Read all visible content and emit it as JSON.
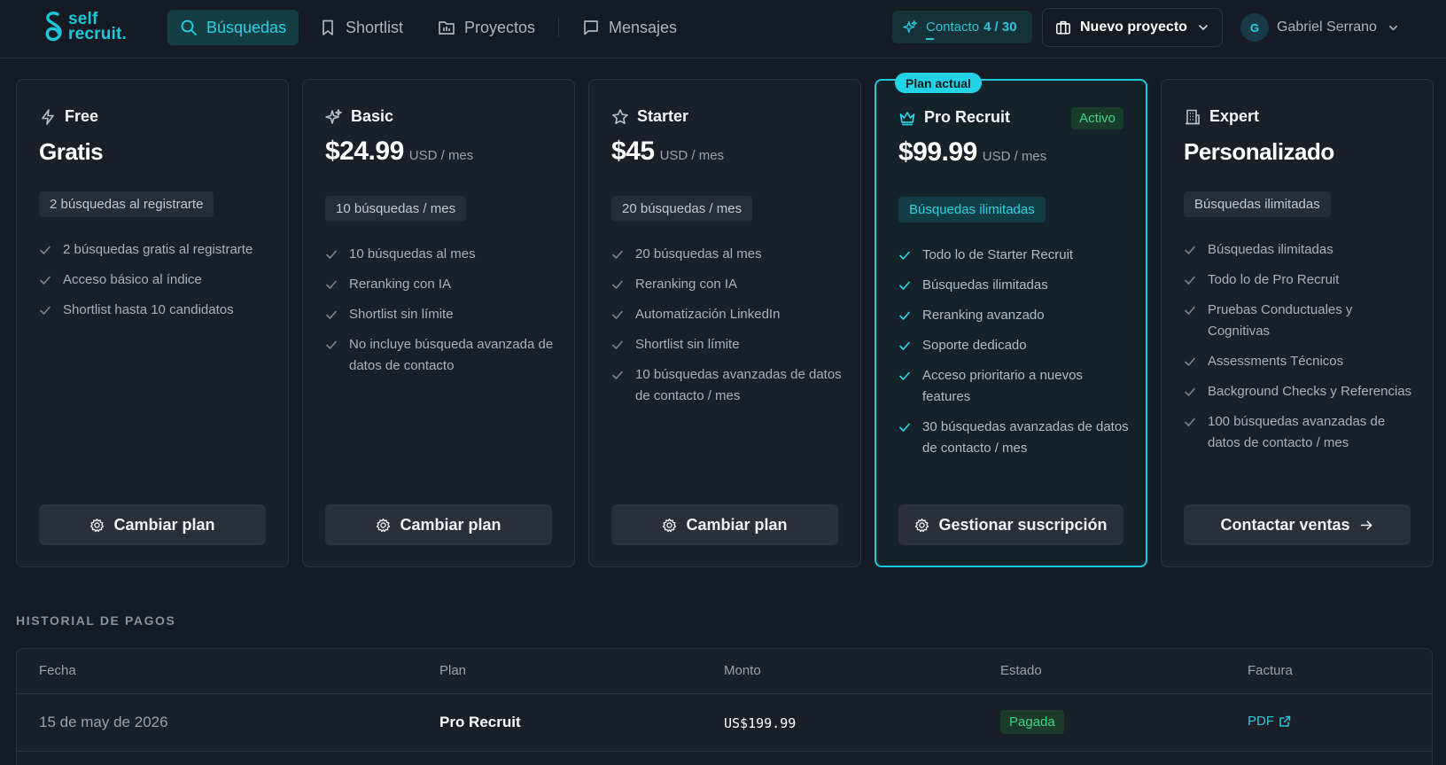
{
  "brand": {
    "line1": "self",
    "line2": "recruit.",
    "accent": "#1cc8dc"
  },
  "nav": [
    {
      "label": "Búsquedas",
      "icon": "search-icon",
      "active": true
    },
    {
      "label": "Shortlist",
      "icon": "bookmark-icon",
      "active": false
    },
    {
      "label": "Proyectos",
      "icon": "folder-icon",
      "active": false
    },
    {
      "label": "Mensajes",
      "icon": "message-icon",
      "active": false
    }
  ],
  "contact": {
    "label": "Contacto",
    "count": "4 / 30",
    "icon": "sparkles-icon"
  },
  "project_select": {
    "label": "Nuevo proyecto",
    "icon": "briefcase-icon"
  },
  "user": {
    "initial": "G",
    "name": "Gabriel Serrano"
  },
  "plans": [
    {
      "name": "Free",
      "icon": "bolt-icon",
      "price": "Gratis",
      "unit": "",
      "quota": "2 búsquedas al registrarte",
      "features": [
        "2 búsquedas gratis al registrarte",
        "Acceso básico al índice",
        "Shortlist hasta 10 candidatos"
      ],
      "button": "Cambiar plan"
    },
    {
      "name": "Basic",
      "icon": "sparkles-icon",
      "price": "$24.99",
      "unit": "USD / mes",
      "quota": "10 búsquedas / mes",
      "features": [
        "10 búsquedas al mes",
        "Reranking con IA",
        "Shortlist sin límite",
        "No incluye búsqueda avanzada de datos de contacto"
      ],
      "button": "Cambiar plan"
    },
    {
      "name": "Starter",
      "icon": "star-icon",
      "price": "$45",
      "unit": "USD / mes",
      "quota": "20 búsquedas / mes",
      "features": [
        "20 búsquedas al mes",
        "Reranking con IA",
        "Automatización LinkedIn",
        "Shortlist sin límite",
        "10 búsquedas avanzadas de datos de contacto / mes"
      ],
      "button": "Cambiar plan"
    },
    {
      "name": "Pro Recruit",
      "icon": "crown-icon",
      "price": "$99.99",
      "unit": "USD / mes",
      "badge": "Plan actual",
      "status": "Activo",
      "quota": "Búsquedas ilimitadas",
      "features": [
        "Todo lo de Starter Recruit",
        "Búsquedas ilimitadas",
        "Reranking avanzado",
        "Soporte dedicado",
        "Acceso prioritario a nuevos features",
        "30 búsquedas avanzadas de datos de contacto / mes"
      ],
      "button": "Gestionar suscripción"
    },
    {
      "name": "Expert",
      "icon": "building-icon",
      "price": "Personalizado",
      "unit": "",
      "quota": "Búsquedas ilimitadas",
      "features": [
        "Búsquedas ilimitadas",
        "Todo lo de Pro Recruit",
        "Pruebas Conductuales y Cognitivas",
        "Assessments Técnicos",
        "Background Checks y Referencias",
        "100 búsquedas avanzadas de datos de contacto / mes"
      ],
      "button": "Contactar ventas"
    }
  ],
  "history": {
    "title": "HISTORIAL DE PAGOS",
    "columns": [
      "Fecha",
      "Plan",
      "Monto",
      "Estado",
      "Factura"
    ],
    "rows": [
      {
        "date": "15 de may de 2026",
        "plan": "Pro Recruit",
        "amount": "US$199.99",
        "status": "Pagada",
        "invoice": "PDF"
      }
    ]
  }
}
